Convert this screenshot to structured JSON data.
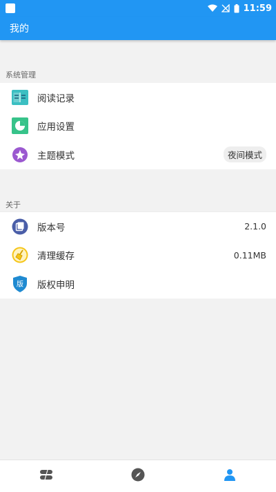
{
  "status_bar": {
    "time": "11:59"
  },
  "app_bar": {
    "title": "我的"
  },
  "system_section": {
    "label": "系统管理",
    "items": [
      {
        "label": "阅读记录",
        "icon": "book-icon"
      },
      {
        "label": "应用设置",
        "icon": "pie-chart-icon"
      },
      {
        "label": "主题模式",
        "icon": "theme-icon",
        "chip": "夜间模式"
      }
    ]
  },
  "about_section": {
    "label": "关于",
    "items": [
      {
        "label": "版本号",
        "icon": "version-icon",
        "value": "2.1.0"
      },
      {
        "label": "清理缓存",
        "icon": "broom-icon",
        "value": "0.11MB"
      },
      {
        "label": "版权申明",
        "icon": "copyright-shield-icon",
        "badge": "版"
      }
    ]
  },
  "bottom_nav": {
    "items": [
      {
        "icon": "bookshelf-icon",
        "active": false
      },
      {
        "icon": "compass-icon",
        "active": false
      },
      {
        "icon": "person-icon",
        "active": true
      }
    ]
  },
  "colors": {
    "primary": "#2196f3",
    "book_teal": "#3bbfc2",
    "settings_green": "#37c38a",
    "theme_purple": "#9b59d0",
    "version_blue": "#4a5ea8",
    "clean_yellow": "#f5c518",
    "shield_blue": "#1f8ad1"
  }
}
